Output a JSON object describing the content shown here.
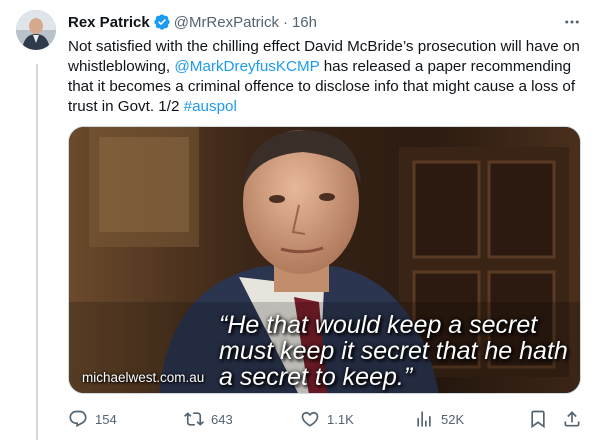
{
  "author": {
    "name": "Rex Patrick",
    "handle": "@MrRexPatrick",
    "separator": "·",
    "time": "16h"
  },
  "tweet": {
    "text_1": "Not satisfied with the chilling effect David McBride’s prosecution will have on whistleblowing, ",
    "mention": "@MarkDreyfusKCMP",
    "text_2": " has released a paper recommending that it becomes a criminal offence to disclose info that might cause a loss of trust in Govt. 1/2 ",
    "hashtag": "#auspol"
  },
  "media": {
    "quote": "“He that would keep a secret must keep it secret that he hath a secret to keep.”",
    "watermark": "michaelwest.com.au"
  },
  "metrics": {
    "replies": "154",
    "retweets": "643",
    "likes": "1.1K",
    "views": "52K"
  },
  "colors": {
    "link": "#1d9bf0",
    "secondary_text": "#536471",
    "verified": "#1d9bf0"
  },
  "icons": [
    "verified-badge-icon",
    "more-icon",
    "reply-icon",
    "retweet-icon",
    "like-icon",
    "views-icon",
    "bookmark-icon",
    "share-icon"
  ]
}
